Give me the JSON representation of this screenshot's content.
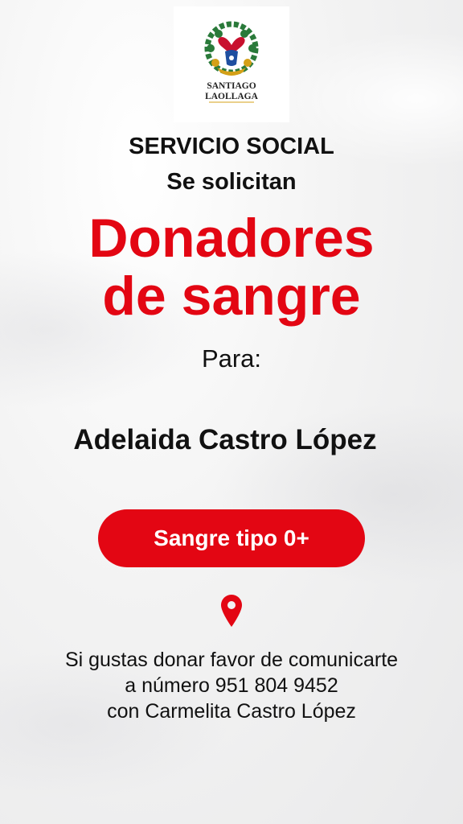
{
  "logo": {
    "name": "logo-santiago-laollaga",
    "text_line1": "SANTIAGO",
    "text_line2": "LAOLLAGA",
    "colors": [
      "#c8102e",
      "#2a7a3a",
      "#1f4fa0",
      "#d4a017"
    ]
  },
  "header": {
    "line1": "SERVICIO SOCIAL",
    "line2": "Se solicitan"
  },
  "headline": {
    "line1": "Donadores",
    "line2": "de sangre",
    "color": "#e30613"
  },
  "recipient": {
    "prefix": "Para:",
    "name": "Adelaida Castro López"
  },
  "blood_type_button": {
    "label": "Sangre tipo 0+",
    "color": "#e30613"
  },
  "location_icon": "map-pin",
  "contact": {
    "line1": "Si gustas donar favor de comunicarte",
    "line2": "a número  951 804 9452",
    "line3": "con Carmelita Castro López"
  }
}
